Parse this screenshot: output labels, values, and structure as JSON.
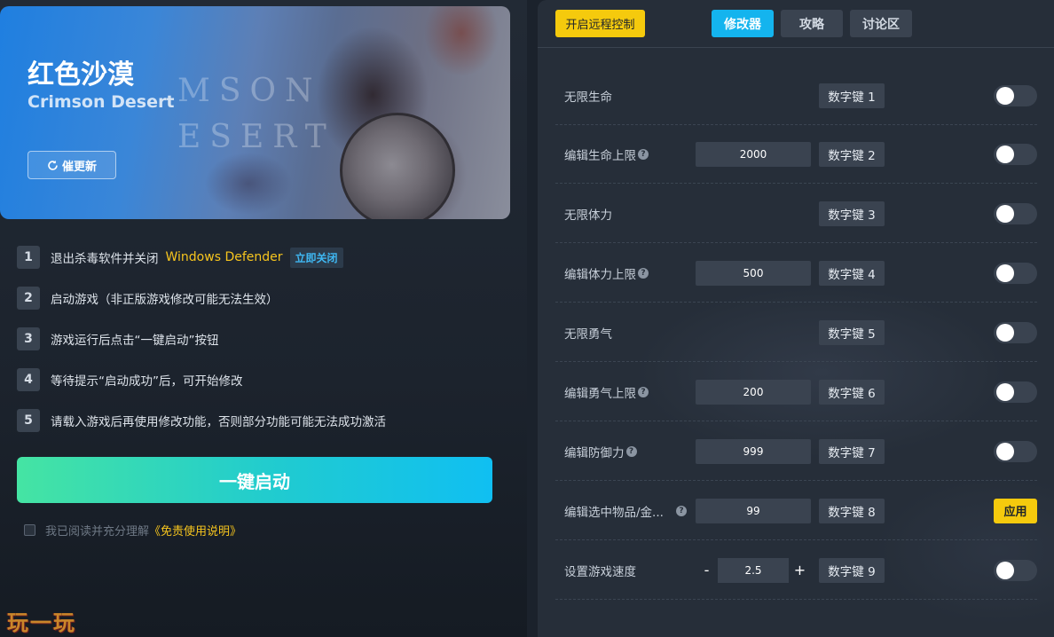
{
  "banner": {
    "title": "红色沙漠",
    "subtitle": "Crimson Desert",
    "update_label": "催更新"
  },
  "steps": [
    {
      "num": "1",
      "text": "退出杀毒软件并关闭",
      "highlight": "Windows Defender",
      "action": "立即关闭"
    },
    {
      "num": "2",
      "text": "启动游戏（非正版游戏修改可能无法生效）"
    },
    {
      "num": "3",
      "text": "游戏运行后点击“一键启动”按钮"
    },
    {
      "num": "4",
      "text": "等待提示“启动成功”后，可开始修改"
    },
    {
      "num": "5",
      "text": "请载入游戏后再使用修改功能，否则部分功能可能无法成功激活"
    }
  ],
  "launch_label": "一键启动",
  "agree": {
    "text": "我已阅读并充分理解",
    "link": "《免责使用说明》"
  },
  "brand": "玩一玩",
  "topbar": {
    "remote_label": "开启远程控制",
    "tabs": [
      "修改器",
      "攻略",
      "讨论区"
    ]
  },
  "cheats": [
    {
      "label": "无限生命",
      "hotkey": "数字键 1",
      "control": "toggle",
      "on": false
    },
    {
      "label": "编辑生命上限",
      "value": "2000",
      "hotkey": "数字键 2",
      "control": "toggle",
      "on": false
    },
    {
      "label": "无限体力",
      "hotkey": "数字键 3",
      "control": "toggle",
      "on": false
    },
    {
      "label": "编辑体力上限",
      "value": "500",
      "hotkey": "数字键 4",
      "control": "toggle",
      "on": false
    },
    {
      "label": "无限勇气",
      "hotkey": "数字键 5",
      "control": "toggle",
      "on": false
    },
    {
      "label": "编辑勇气上限",
      "value": "200",
      "hotkey": "数字键 6",
      "control": "toggle",
      "on": false
    },
    {
      "label": "编辑防御力",
      "value": "999",
      "hotkey": "数字键 7",
      "control": "toggle",
      "on": false
    },
    {
      "label": "编辑选中物品/金...",
      "value": "99",
      "hotkey": "数字键 8",
      "control": "apply",
      "apply_label": "应用"
    },
    {
      "label": "设置游戏速度",
      "value": "2.5",
      "hotkey": "数字键 9",
      "control": "toggle",
      "on": false,
      "minus": "-",
      "plus": "+"
    }
  ],
  "colors": {
    "accent": "#14b4ee",
    "yellow": "#f5ca0d",
    "launch_start": "#45e4a3",
    "launch_end": "#10bff2"
  }
}
